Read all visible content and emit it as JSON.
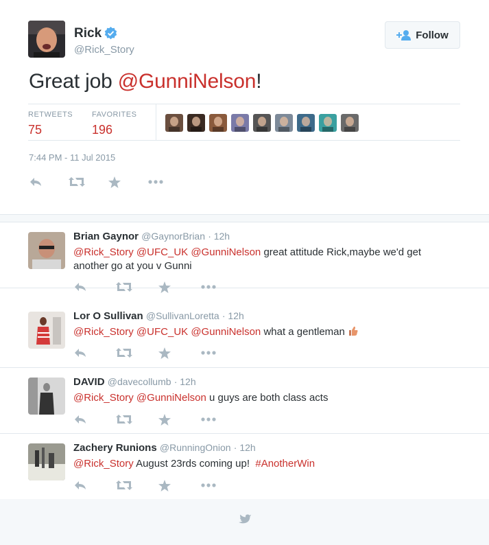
{
  "tweet": {
    "author_name": "Rick",
    "author_handle": "@Rick_Story",
    "text_before": "Great job ",
    "mention": "@GunniNelson",
    "text_after": "!",
    "follow_label": "Follow",
    "retweets_label": "RETWEETS",
    "retweets_count": "75",
    "favorites_label": "FAVORITES",
    "favorites_count": "196",
    "timestamp": "7:44 PM - 11 Jul 2015"
  },
  "favoriters": [
    {
      "color": "#6b4f3f"
    },
    {
      "color": "#3a2a22"
    },
    {
      "color": "#8a5a3c"
    },
    {
      "color": "#7a7aa8"
    },
    {
      "color": "#555555"
    },
    {
      "color": "#7d8a99"
    },
    {
      "color": "#3d6a8a"
    },
    {
      "color": "#3aa0a0"
    },
    {
      "color": "#6a6a6a"
    }
  ],
  "replies": [
    {
      "name": "Brian Gaynor",
      "handle": "@GaynorBrian",
      "time": "· 12h",
      "mention1": "@Rick_Story",
      "mention2": "@UFC_UK",
      "mention3": "@GunniNelson",
      "text": " great attitude Rick,maybe we'd get another go at you v Gunni"
    },
    {
      "name": "Lor O Sullivan",
      "handle": "@SullivanLoretta",
      "time": "· 12h",
      "mention1": "@Rick_Story",
      "mention2": "@UFC_UK",
      "mention3": "@GunniNelson",
      "text": " what a gentleman "
    },
    {
      "name": "DAVID",
      "handle": "@davecollumb",
      "time": "· 12h",
      "mention1": "@Rick_Story",
      "mention2": "@GunniNelson",
      "text": " u guys are both class acts"
    },
    {
      "name": "Zachery Runions",
      "handle": "@RunningOnion",
      "time": "· 12h",
      "mention1": "@Rick_Story",
      "text": " August 23rds coming up!  ",
      "hashtag": "#AnotherWin"
    }
  ],
  "colors": {
    "link": "#c9302c",
    "muted": "#8899a6",
    "verified": "#55acee"
  }
}
